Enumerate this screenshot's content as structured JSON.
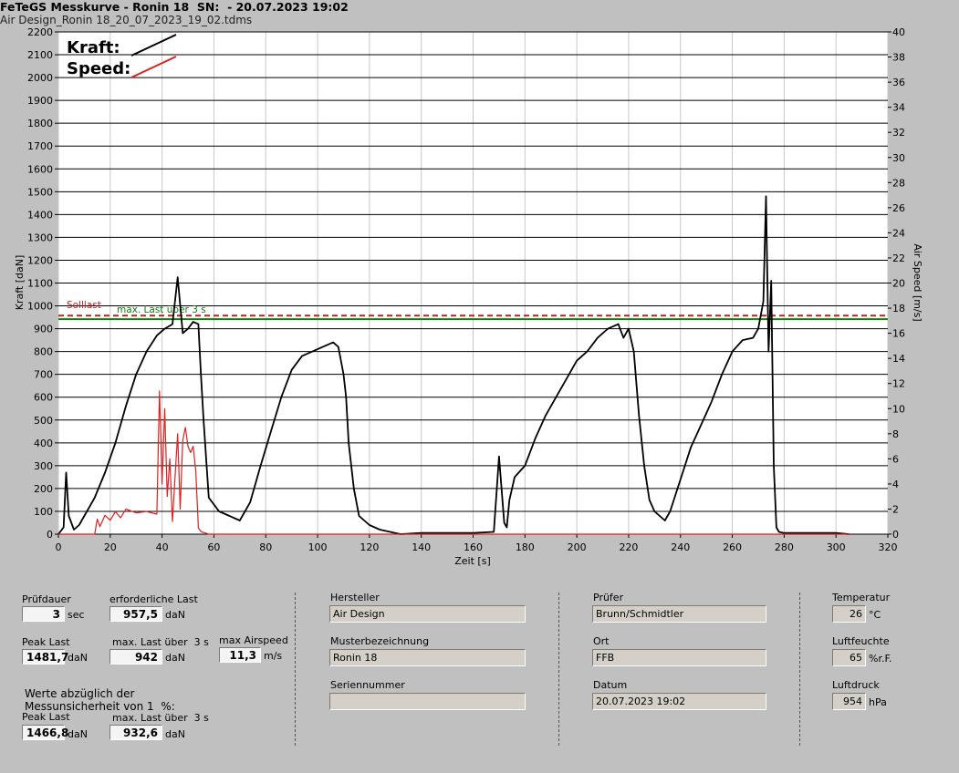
{
  "header": {
    "title_left": "FeTeGS Messkurve - Ronin 18  SN:  - 20.07.2023 19:02",
    "title_right": "Air Design_Ronin 18_20_07_2023_19_02.tdms"
  },
  "chart_data": {
    "type": "line",
    "xlabel": "Zeit [s]",
    "ylabel": "Kraft [daN]",
    "ylabel_right": "Air Speed [m/s]",
    "xlim": [
      0,
      320
    ],
    "ylim": [
      0,
      2200
    ],
    "ylim_right": [
      0,
      40
    ],
    "x_ticks": [
      0,
      20,
      40,
      60,
      80,
      100,
      120,
      140,
      160,
      180,
      200,
      220,
      240,
      260,
      280,
      300,
      320
    ],
    "y_ticks": [
      0,
      100,
      200,
      300,
      400,
      500,
      600,
      700,
      800,
      900,
      1000,
      1100,
      1200,
      1300,
      1400,
      1500,
      1600,
      1700,
      1800,
      1900,
      2000,
      2100,
      2200
    ],
    "y_right_ticks": [
      0,
      2,
      4,
      6,
      8,
      10,
      12,
      14,
      16,
      18,
      20,
      22,
      24,
      26,
      28,
      30,
      32,
      34,
      36,
      38,
      40
    ],
    "legend": [
      {
        "name": "Kraft:",
        "color": "#000000"
      },
      {
        "name": "Speed:",
        "color": "#e02020"
      }
    ],
    "grid": true,
    "reference_lines": [
      {
        "name": "Solllast",
        "value": 957.5,
        "color": "#c02020",
        "style": "dashed"
      },
      {
        "name": "max. Last über  3 s",
        "value": 942,
        "color": "#108010",
        "style": "solid"
      }
    ],
    "series": [
      {
        "name": "Kraft",
        "axis": "left",
        "color": "#000000",
        "x": [
          0,
          2,
          3,
          4,
          6,
          8,
          10,
          14,
          18,
          22,
          26,
          30,
          34,
          38,
          41,
          44,
          46,
          48,
          50,
          52,
          54,
          55,
          56,
          58,
          62,
          66,
          70,
          74,
          78,
          82,
          86,
          90,
          94,
          98,
          102,
          106,
          108,
          110,
          111,
          112,
          114,
          116,
          118,
          120,
          124,
          128,
          130,
          132,
          140,
          150,
          160,
          168,
          170,
          172,
          173,
          174,
          176,
          180,
          184,
          188,
          192,
          196,
          200,
          204,
          208,
          212,
          216,
          218,
          220,
          222,
          224,
          226,
          228,
          230,
          232,
          234,
          236,
          240,
          244,
          248,
          252,
          256,
          260,
          264,
          268,
          270,
          272,
          273,
          274,
          275,
          276,
          277,
          278,
          280,
          290,
          300,
          305
        ],
        "y": [
          0,
          30,
          270,
          80,
          20,
          40,
          80,
          160,
          270,
          400,
          560,
          700,
          800,
          870,
          900,
          920,
          1125,
          880,
          900,
          930,
          920,
          700,
          500,
          160,
          100,
          80,
          60,
          140,
          300,
          450,
          600,
          720,
          780,
          800,
          820,
          840,
          820,
          700,
          600,
          400,
          200,
          80,
          60,
          40,
          20,
          10,
          5,
          0,
          5,
          5,
          5,
          10,
          340,
          50,
          30,
          150,
          250,
          300,
          420,
          520,
          600,
          680,
          760,
          800,
          860,
          900,
          920,
          860,
          900,
          800,
          520,
          300,
          150,
          100,
          80,
          60,
          100,
          240,
          380,
          480,
          580,
          700,
          800,
          850,
          860,
          900,
          1020,
          1480,
          800,
          1110,
          300,
          30,
          10,
          5,
          5,
          5,
          0
        ]
      },
      {
        "name": "Speed",
        "axis": "right",
        "color": "#e02020",
        "x": [
          0,
          14,
          15,
          16,
          18,
          20,
          22,
          24,
          26,
          30,
          34,
          38,
          39,
          40,
          41,
          42,
          43,
          44,
          45,
          46,
          47,
          48,
          49,
          50,
          51,
          52,
          53,
          54,
          55,
          58,
          80,
          120,
          160,
          200,
          240,
          280,
          305
        ],
        "y": [
          0,
          0,
          1.2,
          0.6,
          1.5,
          1.1,
          1.8,
          1.3,
          2.0,
          1.7,
          1.8,
          1.6,
          11.4,
          4.0,
          10.0,
          3.0,
          6.0,
          1.0,
          4.5,
          8.0,
          2.0,
          7.5,
          8.5,
          7.0,
          6.5,
          7.0,
          5.0,
          0.5,
          0.2,
          0,
          0,
          0,
          0,
          0,
          0,
          0,
          0
        ]
      }
    ]
  },
  "panel": {
    "pruefdauer": {
      "label": "Prüfdauer",
      "value": "3",
      "unit": "sec"
    },
    "erforderliche_last": {
      "label": "erforderliche Last",
      "value": "957,5",
      "unit": "daN"
    },
    "peak_last": {
      "label": "Peak Last",
      "value": "1481,7",
      "unit": "daN"
    },
    "max_last_3s": {
      "label": "max. Last über  3 s",
      "value": "942",
      "unit": "daN"
    },
    "max_airspeed": {
      "label": "max Airspeed",
      "value": "11,3",
      "unit": "m/s"
    },
    "werte_note_1": "Werte abzüglich der",
    "werte_note_2": "Messunsicherheit von 1  %:",
    "peak_last_corr": {
      "label": "Peak Last",
      "value": "1466,8",
      "unit": "daN"
    },
    "max_last_3s_corr": {
      "label": "max. Last über  3 s",
      "value": "932,6",
      "unit": "daN"
    },
    "hersteller": {
      "label": "Hersteller",
      "value": "Air Design"
    },
    "musterbezeichnung": {
      "label": "Musterbezeichnung",
      "value": "Ronin 18"
    },
    "seriennummer": {
      "label": "Seriennummer",
      "value": ""
    },
    "pruefer": {
      "label": "Prüfer",
      "value": "Brunn/Schmidtler"
    },
    "ort": {
      "label": "Ort",
      "value": "FFB"
    },
    "datum": {
      "label": "Datum",
      "value": "20.07.2023 19:02"
    },
    "temperatur": {
      "label": "Temperatur",
      "value": "26",
      "unit": "°C"
    },
    "luftfeuchte": {
      "label": "Luftfeuchte",
      "value": "65",
      "unit": "%r.F."
    },
    "luftdruck": {
      "label": "Luftdruck",
      "value": "954",
      "unit": "hPa"
    }
  }
}
